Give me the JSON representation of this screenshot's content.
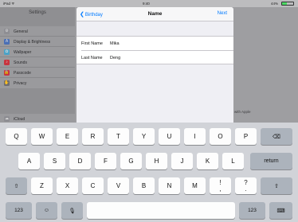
{
  "status_bar": {
    "device": "iPad ᯤ",
    "time": "9:40",
    "battery_text": "44%",
    "battery_level": 0.44
  },
  "sidebar": {
    "title": "Settings",
    "group1": [
      {
        "label": "General",
        "icon": "gear-icon",
        "color": "#8e8e93"
      },
      {
        "label": "Display & Brightness",
        "icon": "text-size-icon",
        "color": "#4a6fb5"
      },
      {
        "label": "Wallpaper",
        "icon": "flower-icon",
        "color": "#4aa3c8"
      },
      {
        "label": "Sounds",
        "icon": "speaker-icon",
        "color": "#c8343f"
      },
      {
        "label": "Passcode",
        "icon": "lock-icon",
        "color": "#c8343f"
      },
      {
        "label": "Privacy",
        "icon": "hand-icon",
        "color": "#6d6d72"
      }
    ],
    "group2": [
      {
        "label": "iCloud",
        "icon": "cloud-icon",
        "color": "#8e8e93"
      }
    ]
  },
  "detail": {
    "apple_note": "with Apple"
  },
  "sheet": {
    "back_label": "Birthday",
    "title": "Name",
    "next_label": "Next",
    "fields": [
      {
        "label": "First Name",
        "value": "Mika"
      },
      {
        "label": "Last Name",
        "value": "Deng"
      }
    ]
  },
  "keyboard": {
    "row1": [
      "Q",
      "W",
      "E",
      "R",
      "T",
      "Y",
      "U",
      "I",
      "O",
      "P"
    ],
    "row2": [
      "A",
      "S",
      "D",
      "F",
      "G",
      "H",
      "J",
      "K",
      "L"
    ],
    "row3": [
      "Z",
      "X",
      "C",
      "V",
      "B",
      "N",
      "M"
    ],
    "punct": [
      {
        "top": "!",
        "bottom": ","
      },
      {
        "top": "?",
        "bottom": "."
      }
    ],
    "return_label": "return",
    "mode_label": "123",
    "backspace_glyph": "⌫",
    "shift_glyph": "⇧",
    "emoji_glyph": "☺",
    "mic_glyph": "🎙",
    "keyboard_glyph": "⌨"
  },
  "colors": {
    "accent": "#007aff",
    "key_bg": "#fdfdfd",
    "fn_key_bg": "#acb3bc",
    "keyboard_bg": "#d1d3d8"
  }
}
